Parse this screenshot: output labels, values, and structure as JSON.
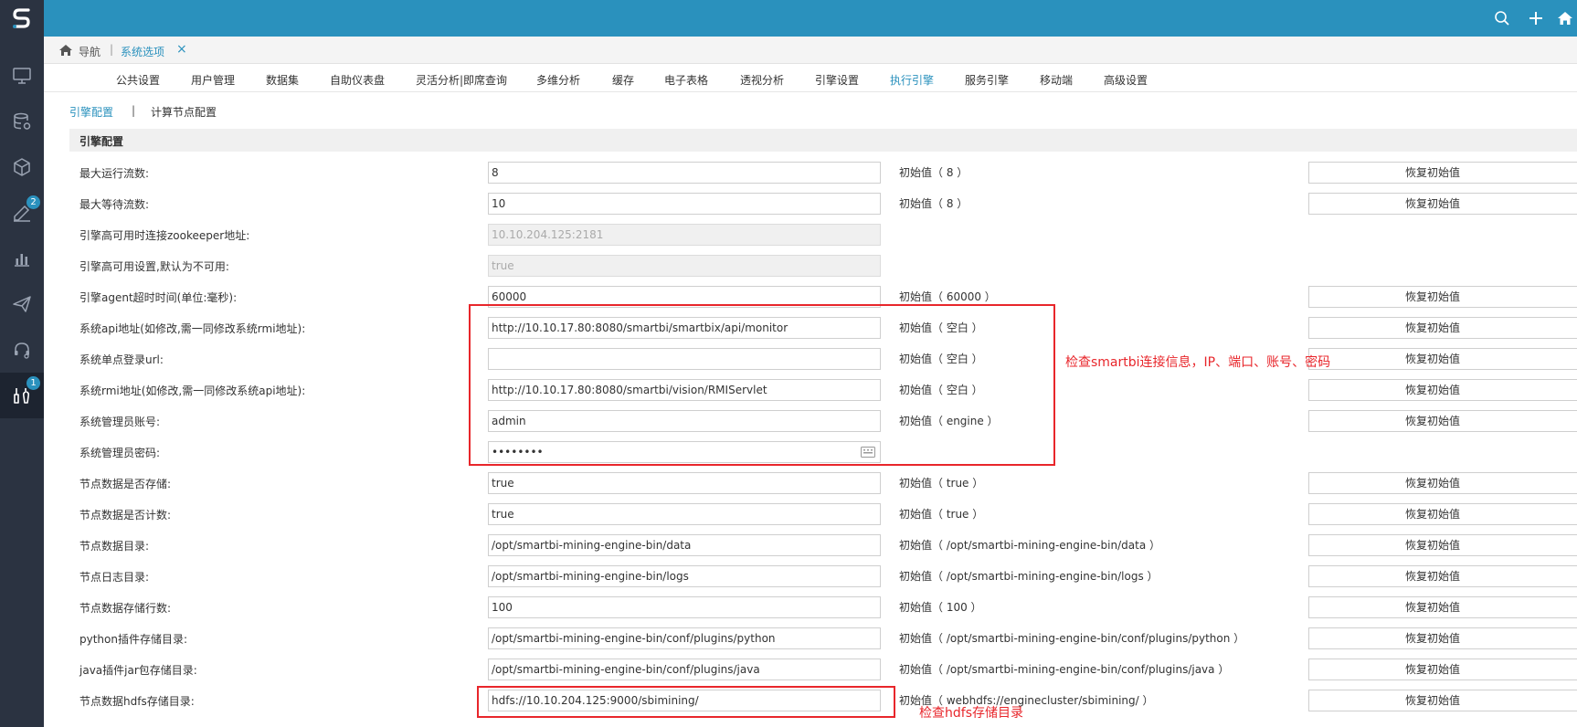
{
  "nav": {
    "home_label": "导航",
    "active_tab": "系统选项",
    "close": "×"
  },
  "sidebar": {
    "badges": {
      "item4": "2",
      "item8": "1"
    }
  },
  "tabs": [
    "公共设置",
    "用户管理",
    "数据集",
    "自助仪表盘",
    "灵活分析|即席查询",
    "多维分析",
    "缓存",
    "电子表格",
    "透视分析",
    "引擎设置",
    "执行引擎",
    "服务引擎",
    "移动端",
    "高级设置"
  ],
  "active_tab_index": 10,
  "subtabs": {
    "engine": "引擎配置",
    "separator": "|",
    "node": "计算节点配置"
  },
  "section_title": "引擎配置",
  "restore_label": "恢复初始值",
  "rows": [
    {
      "label": "最大运行流数:",
      "value": "8",
      "init": "初始值（ 8 ）",
      "restore": true,
      "disabled": false
    },
    {
      "label": "最大等待流数:",
      "value": "10",
      "init": "初始值（ 8 ）",
      "restore": true,
      "disabled": false
    },
    {
      "label": "引擎高可用时连接zookeeper地址:",
      "value": "10.10.204.125:2181",
      "init": "",
      "restore": false,
      "disabled": true
    },
    {
      "label": "引擎高可用设置,默认为不可用:",
      "value": "true",
      "init": "",
      "restore": false,
      "disabled": true
    },
    {
      "label": "引擎agent超时时间(单位:毫秒):",
      "value": "60000",
      "init": "初始值（ 60000 ）",
      "restore": true,
      "disabled": false
    },
    {
      "label": "系统api地址(如修改,需一同修改系统rmi地址):",
      "value": "http://10.10.17.80:8080/smartbi/smartbix/api/monitor",
      "init": "初始值（ 空白 ）",
      "restore": true,
      "disabled": false
    },
    {
      "label": "系统单点登录url:",
      "value": "",
      "init": "初始值（ 空白 ）",
      "restore": true,
      "disabled": false
    },
    {
      "label": "系统rmi地址(如修改,需一同修改系统api地址):",
      "value": "http://10.10.17.80:8080/smartbi/vision/RMIServlet",
      "init": "初始值（ 空白 ）",
      "restore": true,
      "disabled": false
    },
    {
      "label": "系统管理员账号:",
      "value": "admin",
      "init": "初始值（ engine ）",
      "restore": true,
      "disabled": false
    },
    {
      "label": "系统管理员密码:",
      "value": "••••••••",
      "init": "",
      "restore": false,
      "disabled": false,
      "password": true
    },
    {
      "label": "节点数据是否存储:",
      "value": "true",
      "init": "初始值（ true ）",
      "restore": true,
      "disabled": false
    },
    {
      "label": "节点数据是否计数:",
      "value": "true",
      "init": "初始值（ true ）",
      "restore": true,
      "disabled": false
    },
    {
      "label": "节点数据目录:",
      "value": "/opt/smartbi-mining-engine-bin/data",
      "init": "初始值（ /opt/smartbi-mining-engine-bin/data ）",
      "restore": true,
      "disabled": false
    },
    {
      "label": "节点日志目录:",
      "value": "/opt/smartbi-mining-engine-bin/logs",
      "init": "初始值（ /opt/smartbi-mining-engine-bin/logs ）",
      "restore": true,
      "disabled": false
    },
    {
      "label": "节点数据存储行数:",
      "value": "100",
      "init": "初始值（ 100 ）",
      "restore": true,
      "disabled": false
    },
    {
      "label": "python插件存储目录:",
      "value": "/opt/smartbi-mining-engine-bin/conf/plugins/python",
      "init": "初始值（ /opt/smartbi-mining-engine-bin/conf/plugins/python ）",
      "restore": true,
      "disabled": false
    },
    {
      "label": "java插件jar包存储目录:",
      "value": "/opt/smartbi-mining-engine-bin/conf/plugins/java",
      "init": "初始值（ /opt/smartbi-mining-engine-bin/conf/plugins/java ）",
      "restore": true,
      "disabled": false
    },
    {
      "label": "节点数据hdfs存储目录:",
      "value": "hdfs://10.10.204.125:9000/sbimining/",
      "init": "初始值（ webhdfs://enginecluster/sbimining/ ）",
      "restore": true,
      "disabled": false
    }
  ],
  "annotations": {
    "smartbi_note": "检查smartbi连接信息，IP、端口、账号、密码",
    "hdfs_note": "检查hdfs存储目录"
  }
}
